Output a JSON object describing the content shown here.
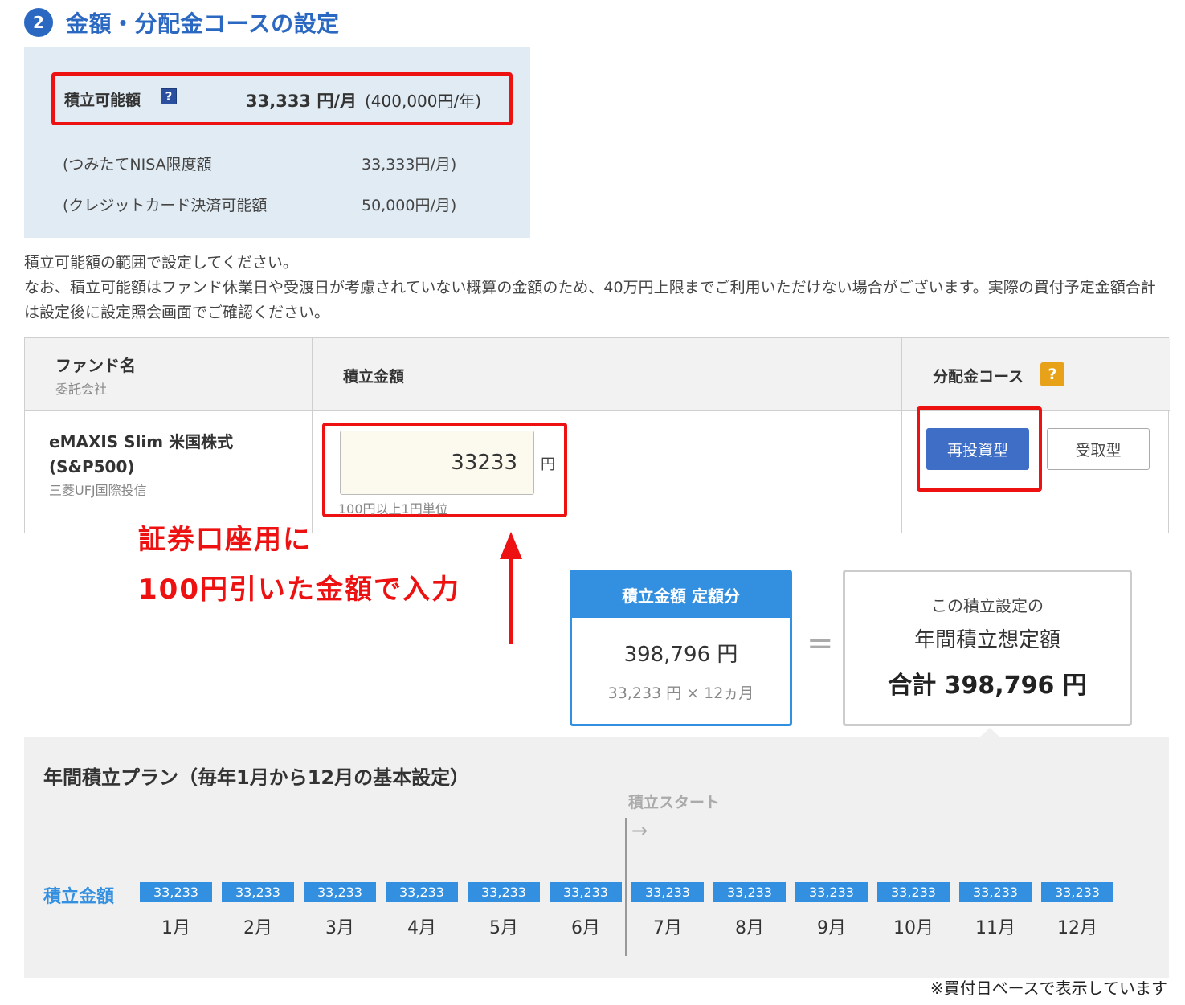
{
  "section": {
    "number": "2",
    "title": "金額・分配金コースの設定"
  },
  "limit": {
    "label": "積立可能額",
    "help": "?",
    "value": "33,333 円/月",
    "year": "(400,000円/年)",
    "rows": [
      {
        "label": "(つみたてNISA限度額",
        "value": "33,333円/月)"
      },
      {
        "label": "(クレジットカード決済可能額",
        "value": "50,000円/月)"
      }
    ]
  },
  "notes": [
    "積立可能額の範囲で設定してください。",
    "なお、積立可能額はファンド休業日や受渡日が考慮されていない概算の金額のため、40万円上限までご利用いただけない場合がございます。実際の買付予定金額合計は設定後に設定照会画面でご確認ください。"
  ],
  "table": {
    "headers": {
      "fund": "ファンド名",
      "company": "委託会社",
      "amount": "積立金額",
      "course": "分配金コース",
      "course_help": "?"
    },
    "fund": {
      "name": "eMAXIS Slim 米国株式(S&P500)",
      "company": "三菱UFJ国際投信"
    },
    "amount": {
      "value": "33233",
      "unit": "円",
      "hint": "100円以上1円単位"
    },
    "course": {
      "reinvest": "再投資型",
      "receive": "受取型",
      "selected": "再投資型"
    }
  },
  "annotation": {
    "line1": "証券口座用に",
    "line2": "100円引いた金額で入力",
    "color": "#ee1111"
  },
  "summary": {
    "head": "積立金額 定額分",
    "value": "398,796 円",
    "calc": "33,233 円 × 12ヵ月",
    "equals": "=",
    "total_l1": "この積立設定の",
    "total_l2": "年間積立想定額",
    "total_l3": "合計  398,796 円"
  },
  "plan": {
    "title": "年間積立プラン（毎年1月から12月の基本設定）",
    "start_label": "積立スタート",
    "start_arrow": "→",
    "row_label": "積立金額",
    "months": [
      {
        "amount": "33,233",
        "label": "1月"
      },
      {
        "amount": "33,233",
        "label": "2月"
      },
      {
        "amount": "33,233",
        "label": "3月"
      },
      {
        "amount": "33,233",
        "label": "4月"
      },
      {
        "amount": "33,233",
        "label": "5月"
      },
      {
        "amount": "33,233",
        "label": "6月"
      },
      {
        "amount": "33,233",
        "label": "7月"
      },
      {
        "amount": "33,233",
        "label": "8月"
      },
      {
        "amount": "33,233",
        "label": "9月"
      },
      {
        "amount": "33,233",
        "label": "10月"
      },
      {
        "amount": "33,233",
        "label": "11月"
      },
      {
        "amount": "33,233",
        "label": "12月"
      }
    ]
  },
  "footnote": "※買付日ベースで表示しています",
  "colors": {
    "accent_blue": "#2a68c2",
    "bar_blue": "#3390e0",
    "button_blue": "#3f6ec6",
    "highlight_red": "#ee1111",
    "help_orange": "#e8a21a"
  }
}
